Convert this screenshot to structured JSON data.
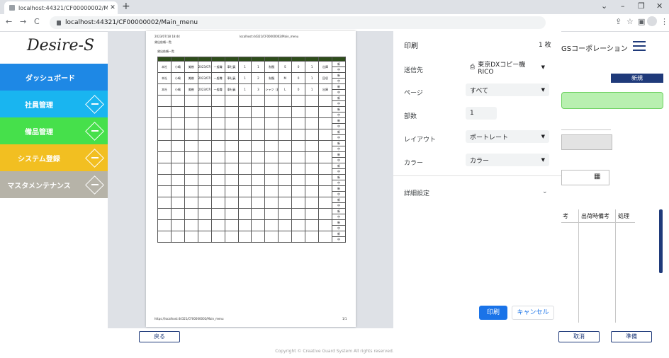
{
  "browser": {
    "tab_title": "localhost:44321/CF00000002/Ma",
    "tab_close": "✕",
    "new_tab": "+",
    "url": "localhost:44321/CF00000002/Main_menu",
    "win_controls": [
      "⌄",
      "–",
      "❐",
      "✕"
    ],
    "nav": [
      "←",
      "→",
      "C"
    ]
  },
  "app": {
    "logo": "Desire-S",
    "org_name": "GSコーポレーション",
    "new_button": "新規",
    "menu": [
      {
        "label": "ダッシュボード",
        "color": "#1e88e5"
      },
      {
        "label": "社員管理",
        "color": "#19b5f0"
      },
      {
        "label": "備品管理",
        "color": "#46e04b"
      },
      {
        "label": "システム登録",
        "color": "#f2bf21"
      },
      {
        "label": "マスタメンテナンス",
        "color": "#b6b3a8"
      }
    ],
    "table_headers": [
      "考",
      "出荷時備考",
      "処理"
    ],
    "back_button": "戻る",
    "cancel_button": "取消",
    "prepare_button": "準備",
    "copyright": "Copyright © Creative Guard System All rights reserved."
  },
  "preview": {
    "header_date": "2023/07/18 18:44",
    "header_title": "localhost:44321/CF00000002/Main_menu",
    "doc_title": "貸出依頼一覧",
    "doc_sub": "貸出依頼一覧",
    "rows": [
      [
        "本社",
        "小嶋",
        "美樹",
        "2023/07/10",
        "一般職",
        "車社員",
        "1",
        "1",
        "制服",
        "S",
        "0",
        "1",
        "出庫"
      ],
      [
        "本社",
        "小嶋",
        "美樹",
        "2023/07/10",
        "一般職",
        "車社員",
        "1",
        "2",
        "制服",
        "M",
        "0",
        "1",
        "回収"
      ],
      [
        "本社",
        "小嶋",
        "美樹",
        "2023/07/10",
        "一般職",
        "車社員",
        "1",
        "3",
        "シャツ（夏）",
        "L",
        "0",
        "1",
        "出庫"
      ]
    ],
    "cell_marks": [
      "新",
      "中"
    ],
    "footer_url": "https://localhost:44321/CF00000002/Main_menu",
    "footer_page": "1/1"
  },
  "print_dialog": {
    "title": "印刷",
    "sheets": "1 枚",
    "destination_label": "送信先",
    "destination_value": "東京DXコピー機 RICO",
    "pages_label": "ページ",
    "pages_value": "すべて",
    "copies_label": "部数",
    "copies_value": "1",
    "layout_label": "レイアウト",
    "layout_value": "ポートレート",
    "color_label": "カラー",
    "color_value": "カラー",
    "more_settings": "詳細設定",
    "print_button": "印刷",
    "cancel_button": "キャンセル"
  }
}
